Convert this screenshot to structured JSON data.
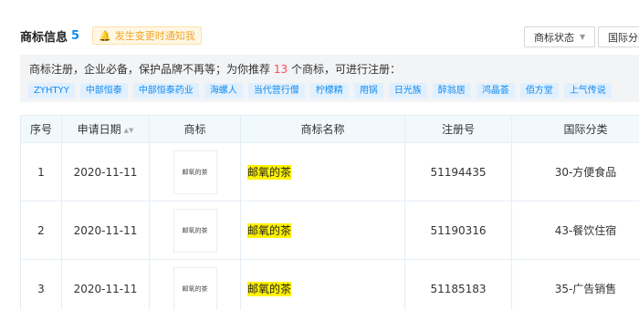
{
  "header": {
    "title": "商标信息",
    "count": "5",
    "notify_label": "发生变更时通知我",
    "filter_status": "商标状态",
    "filter_class": "国际分类"
  },
  "recommend": {
    "text_before": "商标注册，企业必备，保护品牌不再等；为你推荐",
    "number": "13",
    "text_after": "个商标，可进行注册：",
    "tags": [
      "ZYHTYY",
      "中部恒泰",
      "中部恒泰药业",
      "海螺人",
      "当代营行僧",
      "柠檬精",
      "用锅",
      "日光族",
      "醉翁居",
      "鸿晶荟",
      "佰方堂",
      "上气传说"
    ]
  },
  "table": {
    "headers": {
      "index": "序号",
      "date": "申请日期",
      "logo": "商标",
      "name": "商标名称",
      "reg_no": "注册号",
      "class": "国际分类"
    },
    "rows": [
      {
        "index": "1",
        "date": "2020-11-11",
        "logo_text": "邮氧的茶",
        "name": "邮氧的茶",
        "reg_no": "51194435",
        "class": "30-方便食品"
      },
      {
        "index": "2",
        "date": "2020-11-11",
        "logo_text": "邮氧的茶",
        "name": "邮氧的茶",
        "reg_no": "51190316",
        "class": "43-餐饮住宿"
      },
      {
        "index": "3",
        "date": "2020-11-11",
        "logo_text": "邮氧的茶",
        "name": "邮氧的茶",
        "reg_no": "51185183",
        "class": "35-广告销售"
      }
    ]
  }
}
